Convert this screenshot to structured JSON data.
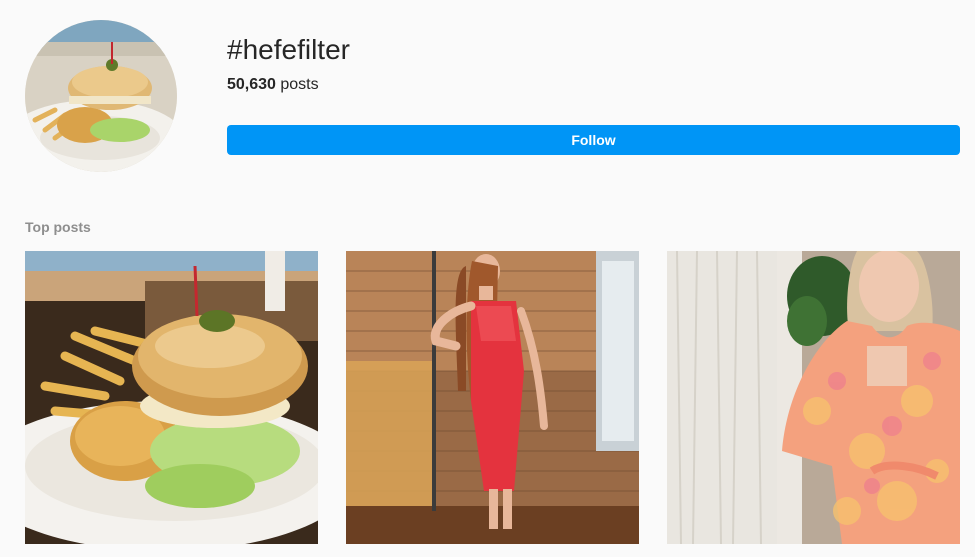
{
  "hashtag": {
    "title": "#hefefilter",
    "post_count": "50,630",
    "post_count_suffix": " posts"
  },
  "actions": {
    "follow_label": "Follow"
  },
  "sections": {
    "top_posts_label": "Top posts"
  },
  "top_posts": [
    {
      "subject": "fried fish sandwich with fries on a plate"
    },
    {
      "subject": "woman in red dress posing by brick wall"
    },
    {
      "subject": "woman in floral robe by window with lace curtains"
    }
  ],
  "colors": {
    "background": "#fafafa",
    "accent": "#0095f6",
    "text": "#262626",
    "muted": "#8e8e8e"
  }
}
